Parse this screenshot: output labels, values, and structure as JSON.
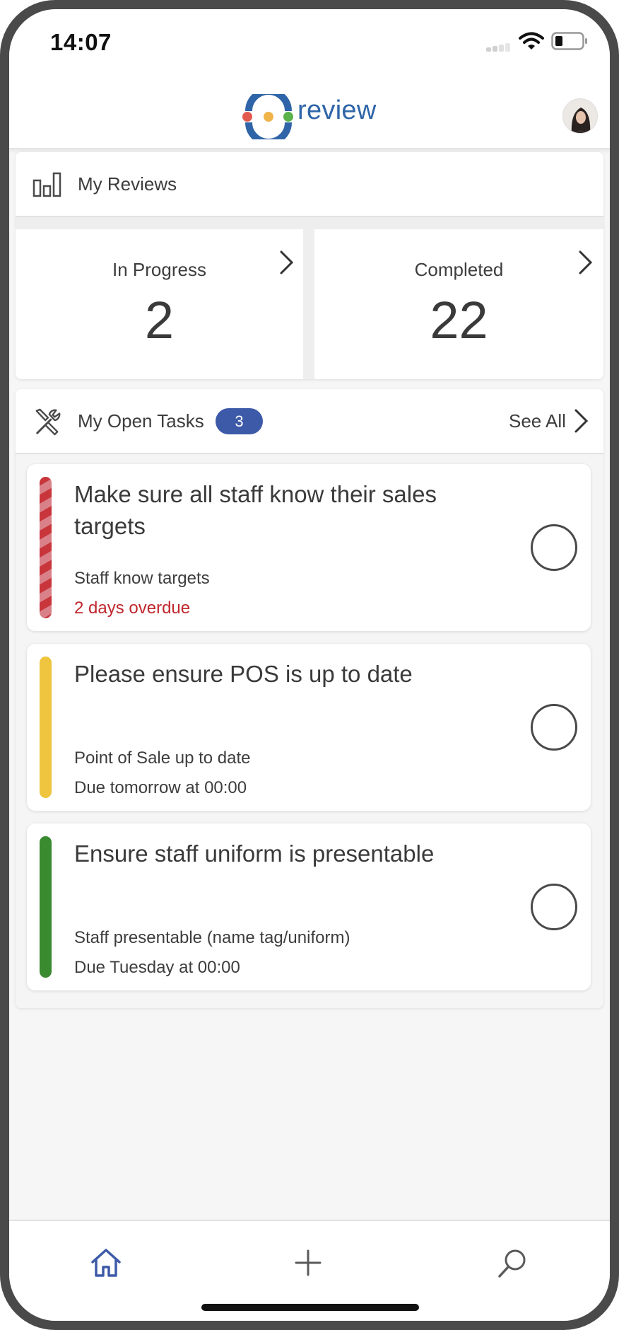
{
  "status_bar": {
    "time": "14:07"
  },
  "header": {
    "brand": "review"
  },
  "my_reviews": {
    "title": "My Reviews",
    "stats": [
      {
        "label": "In Progress",
        "value": "2"
      },
      {
        "label": "Completed",
        "value": "22"
      }
    ]
  },
  "open_tasks": {
    "title": "My Open Tasks",
    "count": "3",
    "see_all": "See All",
    "tasks": [
      {
        "title": "Make sure all staff know their sales targets",
        "subtitle": "Staff know targets",
        "due": "2 days overdue",
        "status": "overdue"
      },
      {
        "title": "Please ensure POS is up to date",
        "subtitle": "Point of Sale up to date",
        "due": "Due tomorrow at 00:00",
        "status": "due-soon"
      },
      {
        "title": "Ensure staff uniform is presentable",
        "subtitle": "Staff presentable (name tag/uniform)",
        "due": "Due Tuesday at 00:00",
        "status": "on-track"
      }
    ]
  },
  "colors": {
    "accent": "#3d5aa8",
    "brand": "#2f65a8",
    "overdue": "#c0272d",
    "warning": "#efc53f",
    "ok": "#3a8a2f"
  },
  "icons": {
    "reviews": "bar-chart-icon",
    "tasks": "tools-icon",
    "nav": [
      "home-icon",
      "plus-icon",
      "search-icon"
    ]
  }
}
